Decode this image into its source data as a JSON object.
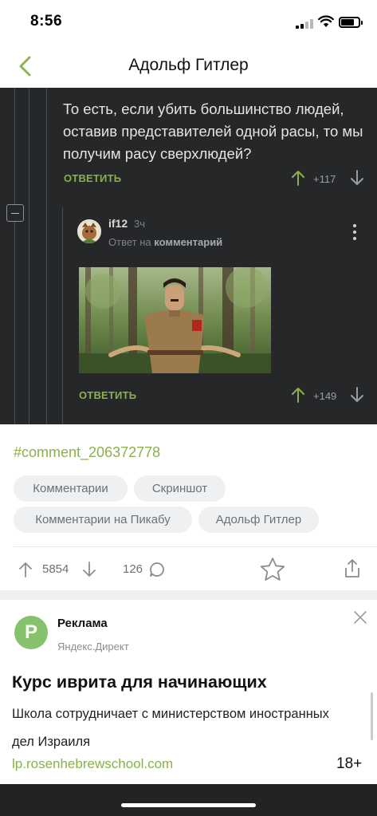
{
  "status_bar": {
    "time": "8:56"
  },
  "header": {
    "title": "Адольф Гитлер"
  },
  "comments": [
    {
      "text": "То есть, если убить большинство людей, оставив представителей одной расы, то мы получим расу сверхлюдей?",
      "reply_label": "ОТВЕТИТЬ",
      "rating": "+117"
    },
    {
      "author": "if12",
      "time_ago": "3ч",
      "reply_prefix": "Ответ на",
      "reply_target": "комментарий",
      "reply_label": "ОТВЕТИТЬ",
      "rating": "+149"
    }
  ],
  "post": {
    "hashtag": "#comment_206372778",
    "tags": [
      "Комментарии",
      "Скриншот",
      "Комментарии на Пикабу",
      "Адольф Гитлер"
    ],
    "rating": "5854",
    "comment_count": "126"
  },
  "ad": {
    "logo_letter": "P",
    "label": "Реклама",
    "source": "Яндекс.Директ",
    "title": "Курс иврита для начинающих",
    "description": "Школа сотрудничает с министерством иностранных дел Израиля",
    "url": "lp.rosenhebrewschool.com",
    "age_rating": "18+"
  },
  "colors": {
    "accent_green": "#8ab14a",
    "dark_bg": "#252729",
    "tag_bg": "#eef0f2"
  }
}
